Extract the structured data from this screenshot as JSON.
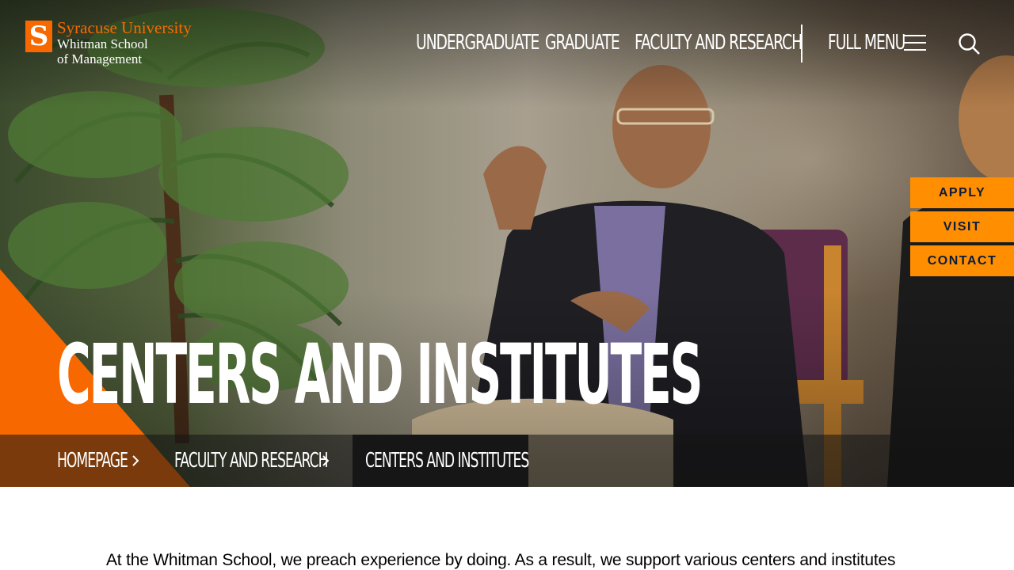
{
  "brand": {
    "logo_letter": "S",
    "university": "Syracuse University",
    "school_line1": "Whitman School",
    "school_line2": "of Management"
  },
  "nav": {
    "undergraduate": "UNDERGRADUATE",
    "graduate": "GRADUATE",
    "faculty_research": "FACULTY AND RESEARCH",
    "full_menu": "FULL MENU"
  },
  "cta": {
    "apply": "APPLY",
    "visit": "VISIT",
    "contact": "CONTACT"
  },
  "hero": {
    "title": "CENTERS AND INSTITUTES"
  },
  "breadcrumb": {
    "items": [
      "HOMEPAGE",
      "FACULTY AND RESEARCH",
      "CENTERS AND INSTITUTES"
    ]
  },
  "content": {
    "intro": "At the Whitman School, we preach experience by doing. As a result, we support various centers and institutes"
  },
  "colors": {
    "brand_orange": "#f76900",
    "cta_orange": "#ff8e00",
    "cta_text": "#0b1c3d"
  },
  "icons": {
    "menu": "hamburger-icon",
    "search": "search-icon",
    "breadcrumb_separator": "chevron-right-icon"
  }
}
